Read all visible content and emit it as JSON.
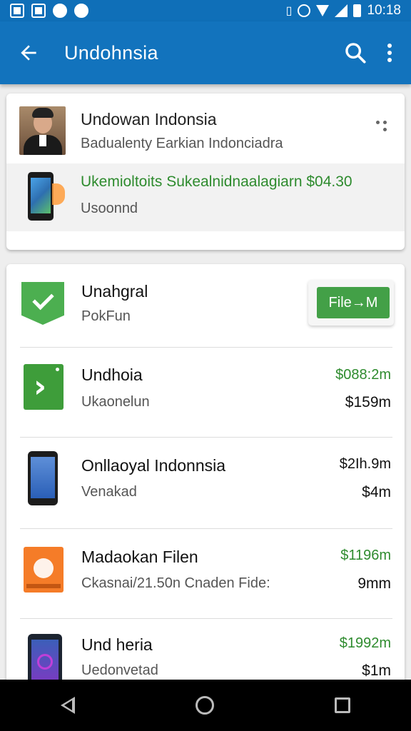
{
  "status_bar": {
    "time": "10:18",
    "icons_left": [
      "image-icon",
      "photo-icon",
      "location-icon",
      "sync-icon"
    ],
    "icons_right": [
      "vibrate-icon",
      "alarm-icon",
      "wifi-icon",
      "signal-icon",
      "battery-icon"
    ]
  },
  "app_bar": {
    "title": "Undohnsia",
    "back_icon": "arrow-back-icon",
    "search_icon": "search-icon",
    "more_icon": "more-vert-icon",
    "color": "#1273bd"
  },
  "profile_card": {
    "name": "Undowan Indonsia",
    "subtitle": "Badualenty Earkian Indonciadra",
    "promo": {
      "text": "Ukemioltoits Sukealnidnaalagiarn $04.30",
      "sub": "Usoonnd",
      "color": "#2e8b2e"
    }
  },
  "list": {
    "items": [
      {
        "title": "Unahgral",
        "sub": "PokFun",
        "button_label": "File→M",
        "icon": "shield-check-icon"
      },
      {
        "title": "Undhoia",
        "sub": "Ukaonelun",
        "price_top": "$088:2m",
        "price_bottom": "$159m",
        "icon": "green-app-icon"
      },
      {
        "title": "Onllaoyal Indonnsia",
        "sub": "Venakad",
        "price_top": "$2Ih.9m",
        "price_bottom": "$4m",
        "icon": "phone-device-icon"
      },
      {
        "title": "Madaokan Filen",
        "sub": "Ckasnai/21.50n Cnaden Fide:",
        "price_top": "$1196m",
        "price_bottom": "9mm",
        "icon": "orange-file-icon"
      },
      {
        "title": "Und heria",
        "sub": "Uedonvetad",
        "price_top": "$1992m",
        "price_bottom": "$1m",
        "icon": "tablet-device-icon"
      }
    ]
  },
  "nav_bar": {
    "back": "nav-back-icon",
    "home": "nav-home-icon",
    "recents": "nav-recents-icon"
  }
}
